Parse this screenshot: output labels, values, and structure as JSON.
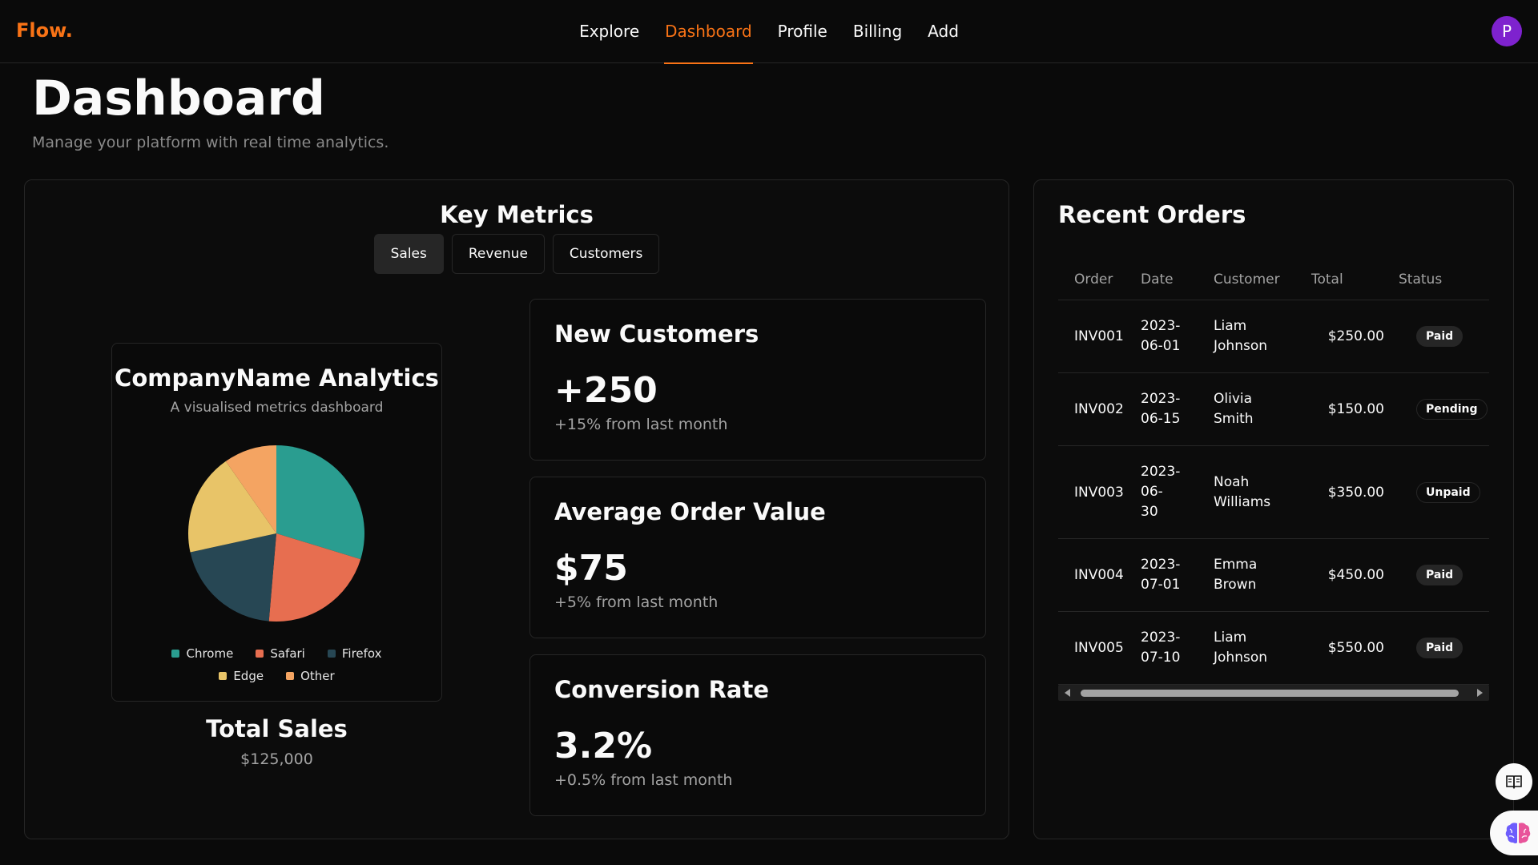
{
  "app": {
    "logo": "Flow."
  },
  "nav": {
    "items": [
      {
        "label": "Explore",
        "active": false
      },
      {
        "label": "Dashboard",
        "active": true
      },
      {
        "label": "Profile",
        "active": false
      },
      {
        "label": "Billing",
        "active": false
      },
      {
        "label": "Add",
        "active": false
      }
    ],
    "avatar_initial": "P"
  },
  "header": {
    "title": "Dashboard",
    "subtitle": "Manage your platform with real time analytics."
  },
  "metrics": {
    "title": "Key Metrics",
    "tabs": [
      {
        "label": "Sales",
        "active": true
      },
      {
        "label": "Revenue",
        "active": false
      },
      {
        "label": "Customers",
        "active": false
      }
    ],
    "analytics": {
      "title": "CompanyName Analytics",
      "subtitle": "A visualised metrics dashboard"
    },
    "total_sales": {
      "label": "Total Sales",
      "value": "$125,000"
    },
    "cards": [
      {
        "label": "New Customers",
        "value": "+250",
        "delta": "+15% from last month"
      },
      {
        "label": "Average Order Value",
        "value": "$75",
        "delta": "+5% from last month"
      },
      {
        "label": "Conversion Rate",
        "value": "3.2%",
        "delta": "+0.5% from last month"
      }
    ]
  },
  "chart_data": {
    "type": "pie",
    "categories": [
      "Chrome",
      "Safari",
      "Firefox",
      "Edge",
      "Other"
    ],
    "values": [
      275,
      200,
      187,
      173,
      90
    ],
    "colors": [
      "#2a9d90",
      "#e76e50",
      "#274754",
      "#e8c468",
      "#f4a462"
    ],
    "legend_position": "bottom"
  },
  "orders": {
    "title": "Recent Orders",
    "columns": [
      "Order",
      "Date",
      "Customer",
      "Total",
      "Status"
    ],
    "rows": [
      {
        "order": "INV001",
        "date": [
          "2023-",
          "06-01"
        ],
        "customer": [
          "Liam",
          "Johnson"
        ],
        "total": "$250.00",
        "status": "Paid"
      },
      {
        "order": "INV002",
        "date": [
          "2023-",
          "06-15"
        ],
        "customer": [
          "Olivia",
          "Smith"
        ],
        "total": "$150.00",
        "status": "Pending"
      },
      {
        "order": "INV003",
        "date": [
          "2023-",
          "06-",
          "30"
        ],
        "customer": [
          "Noah",
          "Williams"
        ],
        "total": "$350.00",
        "status": "Unpaid"
      },
      {
        "order": "INV004",
        "date": [
          "2023-",
          "07-01"
        ],
        "customer": [
          "Emma",
          "Brown"
        ],
        "total": "$450.00",
        "status": "Paid"
      },
      {
        "order": "INV005",
        "date": [
          "2023-",
          "07-10"
        ],
        "customer": [
          "Liam",
          "Johnson"
        ],
        "total": "$550.00",
        "status": "Paid"
      }
    ]
  },
  "floating": {
    "book_icon": "book-open-icon",
    "brain_icon": "brain-icon"
  }
}
